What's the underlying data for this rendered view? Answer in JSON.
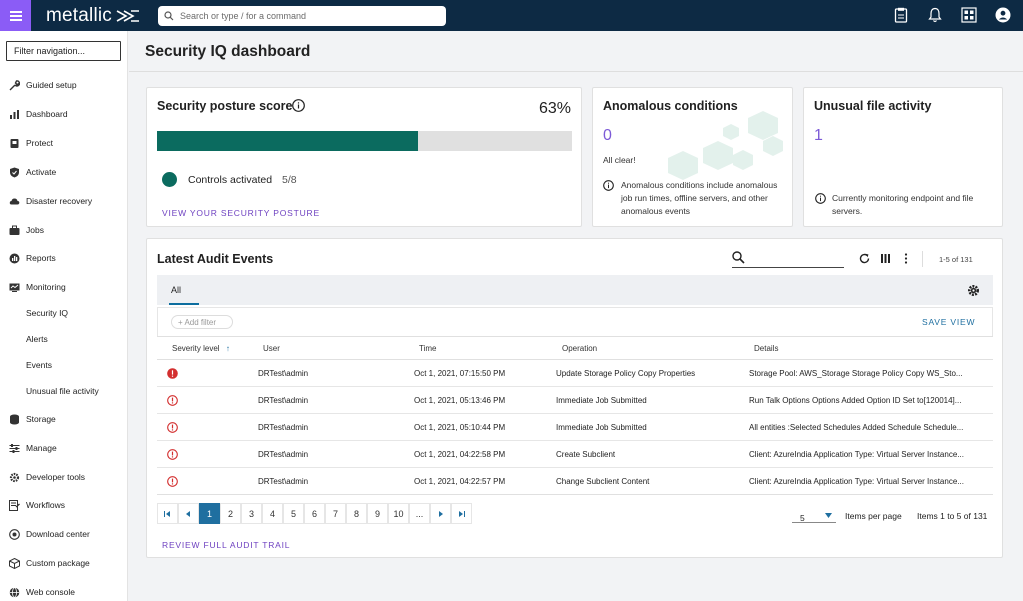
{
  "header": {
    "brand": "metallic",
    "search_placeholder": "Search or type / for a command"
  },
  "sidebar": {
    "filter_placeholder": "Filter navigation...",
    "items": [
      {
        "label": "Guided setup",
        "icon": "wrench-icon"
      },
      {
        "label": "Dashboard",
        "icon": "chart-icon"
      },
      {
        "label": "Protect",
        "icon": "protect-icon"
      },
      {
        "label": "Activate",
        "icon": "shield-icon"
      },
      {
        "label": "Disaster recovery",
        "icon": "cloud-icon"
      },
      {
        "label": "Jobs",
        "icon": "briefcase-icon"
      },
      {
        "label": "Reports",
        "icon": "report-icon"
      },
      {
        "label": "Monitoring",
        "icon": "monitor-icon"
      },
      {
        "label": "Storage",
        "icon": "database-icon"
      },
      {
        "label": "Manage",
        "icon": "sliders-icon"
      },
      {
        "label": "Developer tools",
        "icon": "gear-icon"
      },
      {
        "label": "Workflows",
        "icon": "workflow-icon"
      },
      {
        "label": "Download center",
        "icon": "download-icon"
      },
      {
        "label": "Custom package",
        "icon": "package-icon"
      },
      {
        "label": "Web console",
        "icon": "globe-icon"
      }
    ],
    "monitoring_sub": [
      "Security IQ",
      "Alerts",
      "Events",
      "Unusual file activity"
    ]
  },
  "page": {
    "title": "Security IQ dashboard"
  },
  "posture": {
    "title": "Security posture score",
    "percent_label": "63%",
    "percent": 63,
    "controls_label": "Controls activated",
    "controls_value": "5/8",
    "link": "VIEW YOUR SECURITY POSTURE",
    "bar_color": "#0b6b5f"
  },
  "anomalous": {
    "title": "Anomalous conditions",
    "count": "0",
    "status": "All clear!",
    "note": "Anomalous conditions include anomalous job run times, offline servers, and other anomalous events"
  },
  "unusual": {
    "title": "Unusual file activity",
    "count": "1",
    "note": "Currently monitoring endpoint and file servers."
  },
  "audit": {
    "title": "Latest Audit Events",
    "range": "1-5 of 131",
    "tab": "All",
    "add_filter": "Add filter",
    "save_view": "SAVE VIEW",
    "columns": [
      "Severity level",
      "User",
      "Time",
      "Operation",
      "Details"
    ],
    "rows": [
      {
        "severity": "critical",
        "user": "DRTest\\admin",
        "time": "Oct 1, 2021, 07:15:50 PM",
        "operation": "Update Storage Policy Copy Properties",
        "details": "Storage Pool: AWS_Storage Storage Policy Copy WS_Sto..."
      },
      {
        "severity": "warning",
        "user": "DRTest\\admin",
        "time": "Oct 1, 2021, 05:13:46 PM",
        "operation": "Immediate Job Submitted",
        "details": "Run Talk Options Options Added Option ID Set to[120014]..."
      },
      {
        "severity": "warning",
        "user": "DRTest\\admin",
        "time": "Oct 1, 2021, 05:10:44 PM",
        "operation": "Immediate Job Submitted",
        "details": "All entities :Selected Schedules Added Schedule Schedule..."
      },
      {
        "severity": "warning",
        "user": "DRTest\\admin",
        "time": "Oct 1, 2021, 04:22:58 PM",
        "operation": "Create Subclient",
        "details": "Client: AzureIndia Application Type: Virtual Server Instance..."
      },
      {
        "severity": "warning",
        "user": "DRTest\\admin",
        "time": "Oct 1, 2021, 04:22:57 PM",
        "operation": "Change Subclient Content",
        "details": "Client: AzureIndia Application Type: Virtual Server Instance..."
      }
    ],
    "pages": [
      "1",
      "2",
      "3",
      "4",
      "5",
      "6",
      "7",
      "8",
      "9",
      "10",
      "..."
    ],
    "per_page": "5",
    "per_page_label": "Items per page",
    "items_summary": "Items 1 to 5 of 131",
    "link": "REVIEW FULL AUDIT TRAIL"
  }
}
